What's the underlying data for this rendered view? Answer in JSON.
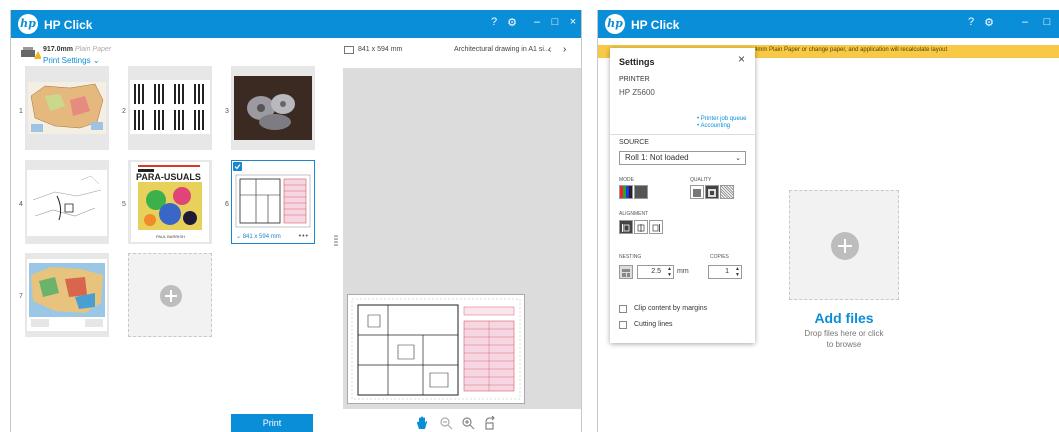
{
  "app": {
    "title": "HP Click",
    "logo_text": "hp",
    "brand_color": "#0a8ed8"
  },
  "window_controls": [
    "?",
    "⚙",
    "–",
    "□",
    "×"
  ],
  "left": {
    "media": {
      "size": "917.0mm",
      "type": "Plain Paper"
    },
    "print_settings_label": "Print Settings",
    "thumbnails": [
      {
        "index": "1"
      },
      {
        "index": "2"
      },
      {
        "index": "3"
      },
      {
        "index": "4"
      },
      {
        "index": "5",
        "cover_headline": "PARA-USUALS",
        "cover_caption": "PAUL BARRISH"
      },
      {
        "index": "6",
        "selected": true,
        "size_label": "841 x 594 mm",
        "menu": "•••"
      },
      {
        "index": "7"
      }
    ],
    "print_button": "Print",
    "preview": {
      "size": "841 x 594 mm",
      "name": "Architectural drawing in A1 si...",
      "prev": "‹",
      "next": "›"
    },
    "tools": [
      "hand-icon",
      "zoom-out-icon",
      "zoom-in-icon",
      "rotate-icon"
    ]
  },
  "right": {
    "banner": "4mm Plain Paper or change paper, and application will recalculate layout",
    "add_files_title": "Add files",
    "add_files_sub_1": "Drop files here or click",
    "add_files_sub_2": "to browse",
    "settings": {
      "title": "Settings",
      "close": "×",
      "printer_label": "PRINTER",
      "printer_name": "HP Z5600",
      "link_queue": "Printer job queue",
      "link_accounting": "Accounting",
      "source_label": "SOURCE",
      "source_value": "Roll 1: Not loaded",
      "mode_label": "MODE",
      "quality_label": "QUALITY",
      "alignment_label": "ALIGNMENT",
      "nesting_label": "NESTING",
      "nesting_value": "2.5",
      "nesting_unit": "mm",
      "copies_label": "COPIES",
      "copies_value": "1",
      "clip_label": "Clip content by margins",
      "cutting_label": "Cutting lines"
    }
  }
}
